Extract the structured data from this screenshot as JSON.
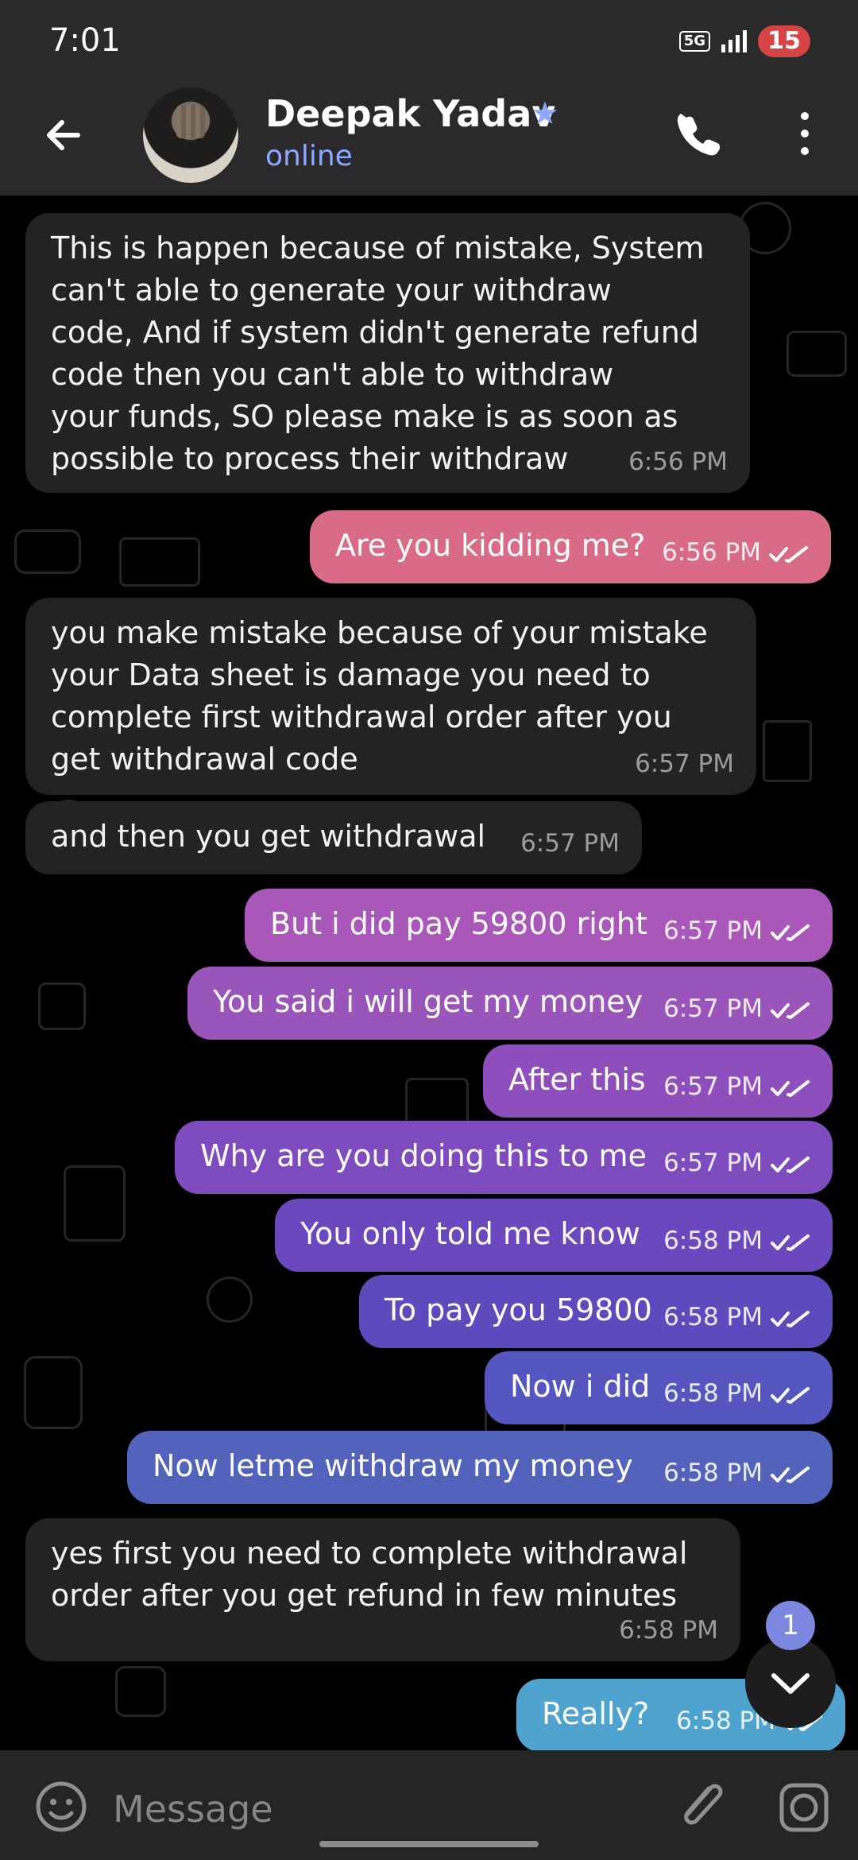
{
  "status_bar": {
    "time": "7:01",
    "network": "5G",
    "battery": "15"
  },
  "header": {
    "name": "Deepak Yadav",
    "status": "online"
  },
  "messages": [
    {
      "direction": "incoming",
      "text": "This is happen because of mistake, System\ncan't able to generate your withdraw\ncode, And if system didn't generate refund\ncode then you can't able to withdraw\nyour funds, SO please make is as soon as\npossible to process their withdraw",
      "time": "6:56 PM"
    },
    {
      "direction": "outgoing",
      "text": "Are you kidding me?",
      "time": "6:56 PM",
      "color": "#d96b86"
    },
    {
      "direction": "incoming",
      "text": "you make mistake because of your mistake\nyour Data sheet is damage you need to\ncomplete first withdrawal order after you\nget withdrawal code",
      "time": "6:57 PM"
    },
    {
      "direction": "incoming",
      "text": "and then you get withdrawal",
      "time": "6:57 PM"
    },
    {
      "direction": "outgoing",
      "text": "But i did pay 59800 right",
      "time": "6:57 PM",
      "color": "#a957b8"
    },
    {
      "direction": "outgoing",
      "text": "You said i will get my money",
      "time": "6:57 PM",
      "color": "#9a55ba"
    },
    {
      "direction": "outgoing",
      "text": "After this",
      "time": "6:57 PM",
      "color": "#8e4fbc"
    },
    {
      "direction": "outgoing",
      "text": "Why are you doing this to me",
      "time": "6:57 PM",
      "color": "#7f4cbf"
    },
    {
      "direction": "outgoing",
      "text": "You only told me know",
      "time": "6:58 PM",
      "color": "#6b48bd"
    },
    {
      "direction": "outgoing",
      "text": "To pay you 59800",
      "time": "6:58 PM",
      "color": "#5d4abd"
    },
    {
      "direction": "outgoing",
      "text": "Now i did",
      "time": "6:58 PM",
      "color": "#5556bf"
    },
    {
      "direction": "outgoing",
      "text": "Now letme withdraw my money",
      "time": "6:58 PM",
      "color": "#5362ba"
    },
    {
      "direction": "incoming",
      "text": "yes first you need to complete withdrawal\norder after you get refund in few minutes",
      "time": "6:58 PM"
    },
    {
      "direction": "outgoing",
      "text": "Really?",
      "time": "6:58 PM",
      "color": "#4ea3cf"
    }
  ],
  "unread_badge": "1",
  "composer": {
    "placeholder": "Message"
  },
  "icons": {
    "back": "back-arrow-icon",
    "verified": "star-icon",
    "call": "phone-icon",
    "menu": "more-vertical-icon",
    "read_status": "double-check-icon",
    "scroll": "chevron-down-icon",
    "emoji": "emoji-icon",
    "attach": "paperclip-icon",
    "camera": "camera-icon"
  }
}
